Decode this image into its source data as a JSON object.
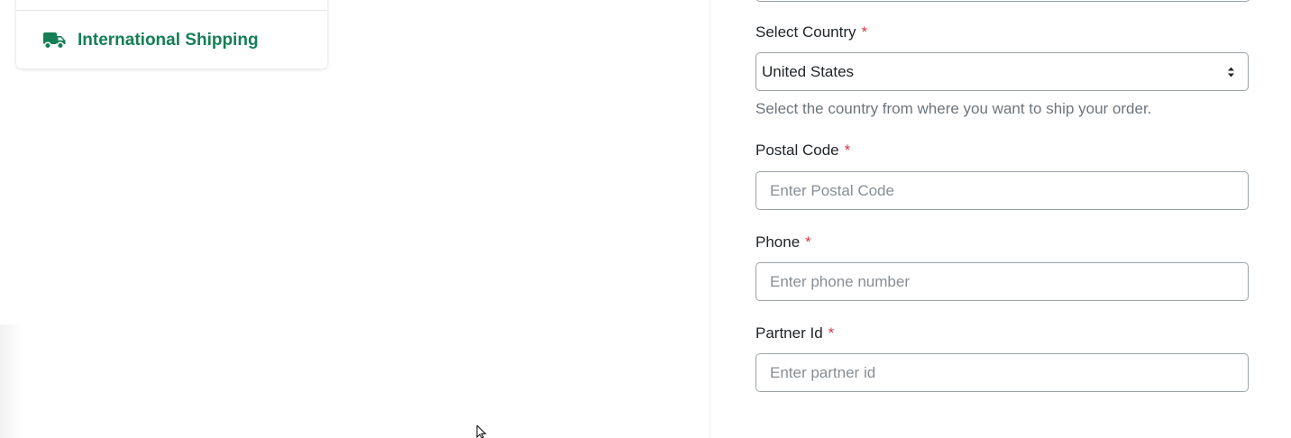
{
  "sidebar": {
    "items": [
      {
        "label": "International Shipping",
        "icon": "truck-icon"
      }
    ],
    "accent_color": "#157f55"
  },
  "form": {
    "required_marker": "*",
    "country": {
      "label": "Select Country",
      "selected": "United States",
      "help": "Select the country from where you want to ship your order."
    },
    "postal_code": {
      "label": "Postal Code",
      "placeholder": "Enter Postal Code"
    },
    "phone": {
      "label": "Phone",
      "placeholder": "Enter phone number"
    },
    "partner_id": {
      "label": "Partner Id",
      "placeholder": "Enter partner id"
    }
  },
  "colors": {
    "required": "#dc3545",
    "help_text": "#6c757d",
    "border": "#9ba1a7"
  }
}
